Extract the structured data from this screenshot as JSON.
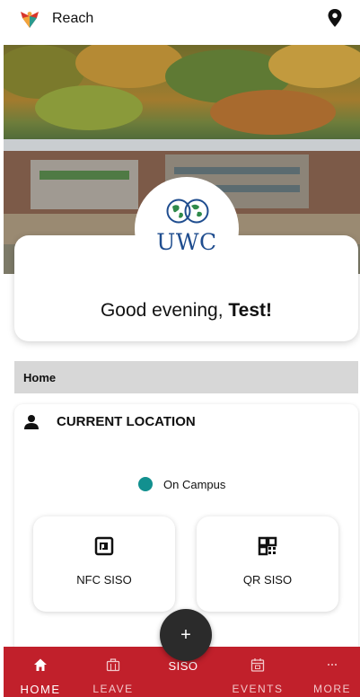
{
  "app": {
    "name": "Reach",
    "logo_icon": "reach-logo-icon",
    "location_icon": "map-pin-icon"
  },
  "hero": {
    "brand": "UWC",
    "brand_color": "#1f4d8f",
    "emblem_icon": "uwc-globes-icon"
  },
  "greeting": {
    "prefix": "Good evening, ",
    "name": "Test!"
  },
  "section": {
    "title": "Home"
  },
  "location": {
    "title": "CURRENT LOCATION",
    "icon": "person-icon",
    "status_label": "On Campus",
    "status_color": "#12908f",
    "actions": [
      {
        "label": "NFC SISO",
        "icon": "nfc-icon"
      },
      {
        "label": "QR SISO",
        "icon": "qr-code-icon"
      }
    ]
  },
  "fab": {
    "label": "+",
    "icon": "plus-icon"
  },
  "nav": {
    "accent": "#c1202b",
    "items": [
      {
        "label": "HOME",
        "icon": "home-icon",
        "active": true
      },
      {
        "label": "LEAVE",
        "icon": "briefcase-icon"
      },
      {
        "label": "SISO",
        "icon": ""
      },
      {
        "label": "EVENTS",
        "icon": "calendar-icon"
      },
      {
        "label": "MORE",
        "icon": "more-icon"
      }
    ]
  }
}
